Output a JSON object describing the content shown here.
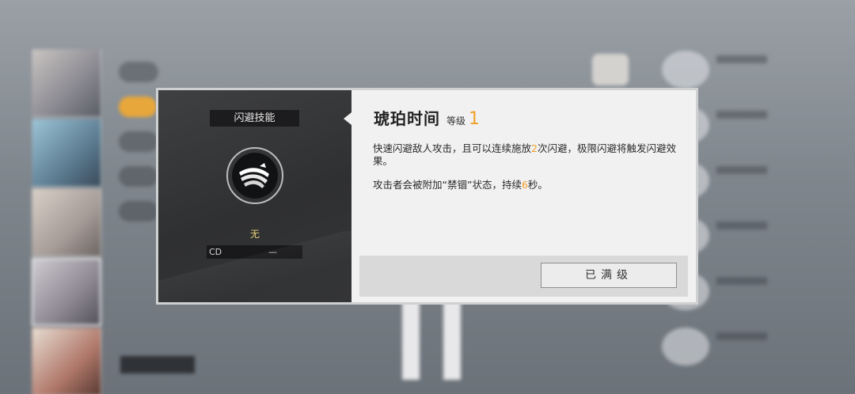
{
  "dialog": {
    "skill_type": "闪避技能",
    "skill_name": "琥珀时间",
    "level_label": "等级",
    "level_value": "1",
    "cost": "无",
    "cd_label": "CD",
    "cd_value": "—",
    "description": {
      "p1_a": "快速闪避敌人攻击，且可以连续施放",
      "p1_num": "2",
      "p1_b": "次闪避，极限闪避将触发闪避效果。",
      "p2_a": "攻击者会被附加“禁锢”状态，持续",
      "p2_num": "6",
      "p2_b": "秒。"
    },
    "button_label": "已满级"
  },
  "colors": {
    "accent": "#f0a02a",
    "cost_text": "#e7d07a",
    "dark_panel": "#343537",
    "light_panel": "#f1f1f1"
  },
  "icons": {
    "skill_icon": "claw-slash-icon"
  }
}
